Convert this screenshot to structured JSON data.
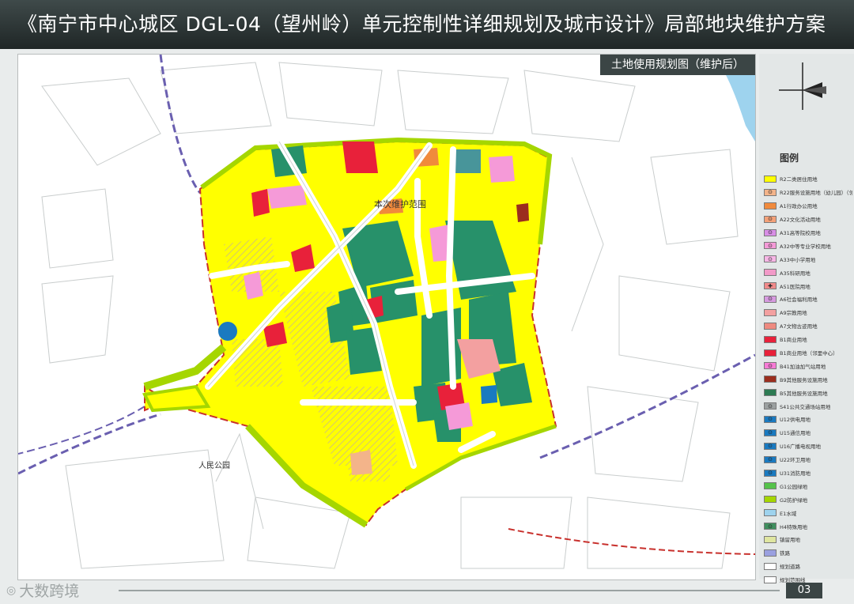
{
  "header": {
    "title": "《南宁市中心城区 DGL-04（望州岭）单元控制性详细规划及城市设计》局部地块维护方案"
  },
  "map": {
    "subtitle": "土地使用规划图（维护后）",
    "labels": {
      "maintenance_scope": "本次维护范围",
      "peoples_park": "人民公园"
    },
    "colors": {
      "residential": "#ffff00",
      "green_space": "#27916a",
      "protective_green": "#a5d600",
      "commercial": "#e8213a",
      "education": "#f59ad8",
      "road": "#ffffff",
      "boundary": "#c8302c",
      "railway": "#6a5fb0"
    }
  },
  "legend": {
    "title": "图例",
    "items": [
      {
        "code": "",
        "label": "R2二类居住用地",
        "color": "#ffff00"
      },
      {
        "code": "⊙",
        "label": "R22服务设施用地（幼儿园）（邻里中心）",
        "color": "#f3b48a"
      },
      {
        "code": "",
        "label": "A1行政办公用地",
        "color": "#f08a3c"
      },
      {
        "code": "⊙",
        "label": "A22文化活动用地",
        "color": "#f4a178"
      },
      {
        "code": "⊙",
        "label": "A31高等院校用地",
        "color": "#d88ee6"
      },
      {
        "code": "⊙",
        "label": "A32中等专业学校用地",
        "color": "#f59ad8"
      },
      {
        "code": "⊙",
        "label": "A33中小学用地",
        "color": "#f7b6e6"
      },
      {
        "code": "",
        "label": "A35科研用地",
        "color": "#f29ac8"
      },
      {
        "code": "✚",
        "label": "A51医院用地",
        "color": "#f08a8a"
      },
      {
        "code": "⊙",
        "label": "A6社会福利用地",
        "color": "#d79ae0"
      },
      {
        "code": "",
        "label": "A9宗教用地",
        "color": "#f3a0a0"
      },
      {
        "code": "",
        "label": "A7文物古迹用地",
        "color": "#ee8a80"
      },
      {
        "code": "",
        "label": "B1商业用地",
        "color": "#e8213a"
      },
      {
        "code": "",
        "label": "B1商业用地（邻里中心）",
        "color": "#e8213a"
      },
      {
        "code": "⊙",
        "label": "B41加油加气站用地",
        "color": "#f77bd6"
      },
      {
        "code": "",
        "label": "B9其他服务设施用地",
        "color": "#9b2d1e"
      },
      {
        "code": "",
        "label": "B5其他服务设施用地",
        "color": "#2c7a52"
      },
      {
        "code": "⊙",
        "label": "S41公共交通场站用地",
        "color": "#9ba0a0"
      },
      {
        "code": "⊙",
        "label": "U12供电用地",
        "color": "#1a7ac0"
      },
      {
        "code": "⊙",
        "label": "U15通信用地",
        "color": "#1a7ac0"
      },
      {
        "code": "⊙",
        "label": "U16广播电视用地",
        "color": "#1a7ac0"
      },
      {
        "code": "⊙",
        "label": "U22环卫用地",
        "color": "#1a7ac0"
      },
      {
        "code": "⊙",
        "label": "U31消防用地",
        "color": "#1a7ac0"
      },
      {
        "code": "",
        "label": "G1公园绿地",
        "color": "#54c24a"
      },
      {
        "code": "",
        "label": "G2防护绿地",
        "color": "#a5d600"
      },
      {
        "code": "",
        "label": "E1水域",
        "color": "#9ed3ee"
      },
      {
        "code": "⊙",
        "label": "H4特殊用地",
        "color": "#3f8f5f"
      },
      {
        "code": "",
        "label": "镇留用地",
        "color": "#dfe6a0"
      },
      {
        "code": "",
        "label": "铁路",
        "color": "#9aa0e0"
      },
      {
        "code": "",
        "label": "规划道路",
        "color": "#ffffff"
      },
      {
        "code": "",
        "label": "规划范围线",
        "color": "#ffffff"
      }
    ]
  },
  "footer": {
    "watermark": "大数跨境",
    "page_number": "03"
  }
}
